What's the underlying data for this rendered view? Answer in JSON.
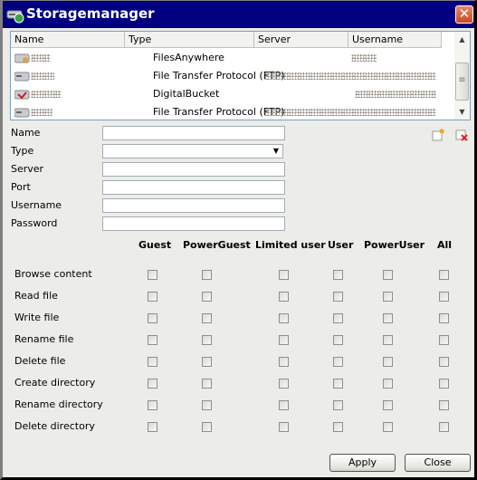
{
  "window": {
    "title": "Storagemanager",
    "icon": "storage-drive-icon",
    "close_glyph": "✕"
  },
  "list": {
    "columns": [
      "Name",
      "Type",
      "Server",
      "Username"
    ],
    "rows": [
      {
        "icon": "filesanywhere-drive-icon",
        "name": "[obfuscated]",
        "type": "FilesAnywhere",
        "server": "",
        "username": "[obfuscated]"
      },
      {
        "icon": "ftp-drive-icon",
        "name": "[obfuscated]",
        "type": "File Transfer Protocol (FTP)",
        "server": "[obfuscated]",
        "username": "[obfuscated]"
      },
      {
        "icon": "digitalbucket-drive-icon",
        "name": "[obfuscated]",
        "type": "DigitalBucket",
        "server": "",
        "username": "[obfuscated]"
      },
      {
        "icon": "ftp-drive-icon",
        "name": "[obfuscated]",
        "type": "File Transfer Protocol (FTP)",
        "server": "[obfuscated]",
        "username": "[obfuscated]"
      }
    ]
  },
  "form": {
    "name_label": "Name",
    "name_value": "",
    "type_label": "Type",
    "type_value": "",
    "server_label": "Server",
    "server_value": "",
    "port_label": "Port",
    "port_value": "",
    "username_label": "Username",
    "username_value": "",
    "password_label": "Password",
    "password_value": ""
  },
  "permissions": {
    "groups": [
      "Guest",
      "PowerGuest",
      "Limited user",
      "User",
      "PowerUser",
      "All"
    ],
    "actions": [
      "Browse content",
      "Read file",
      "Write file",
      "Rename file",
      "Delete file",
      "Create directory",
      "Rename directory",
      "Delete directory"
    ],
    "checked": false
  },
  "buttons": {
    "apply": "Apply",
    "close": "Close"
  }
}
